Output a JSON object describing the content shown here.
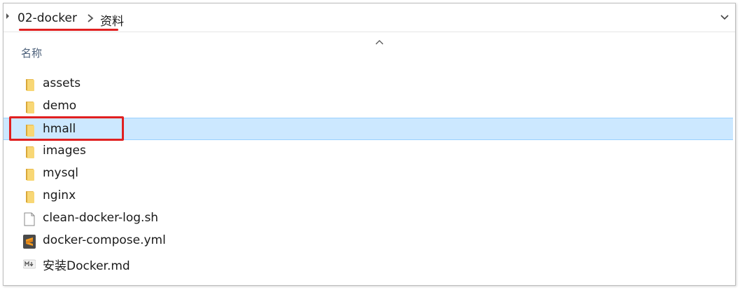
{
  "breadcrumb": {
    "items": [
      "02-docker",
      "资料"
    ]
  },
  "header": {
    "name_column": "名称"
  },
  "files": [
    {
      "name": "assets",
      "icon": "folder-icon",
      "selected": false
    },
    {
      "name": "demo",
      "icon": "folder-icon",
      "selected": false
    },
    {
      "name": "hmall",
      "icon": "folder-icon",
      "selected": true
    },
    {
      "name": "images",
      "icon": "folder-icon",
      "selected": false
    },
    {
      "name": "mysql",
      "icon": "folder-icon",
      "selected": false
    },
    {
      "name": "nginx",
      "icon": "folder-icon",
      "selected": false
    },
    {
      "name": "clean-docker-log.sh",
      "icon": "file-icon",
      "selected": false
    },
    {
      "name": "docker-compose.yml",
      "icon": "sublime-text-icon",
      "selected": false
    },
    {
      "name": "安装Docker.md",
      "icon": "markdown-icon",
      "selected": false
    }
  ],
  "colors": {
    "selection_bg": "#cce8ff",
    "selection_border": "#99d1ff",
    "annotation_red": "#e02020",
    "folder_yellow": "#f8d775"
  }
}
